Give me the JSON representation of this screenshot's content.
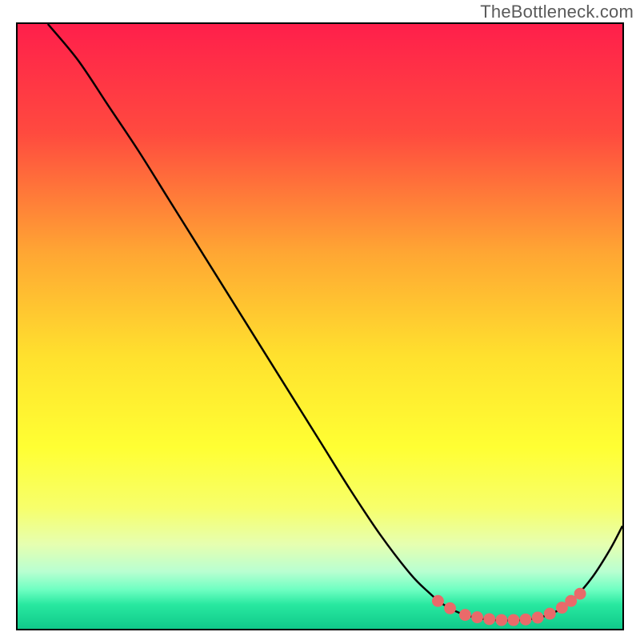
{
  "watermark": "TheBottleneck.com",
  "chart_data": {
    "type": "line",
    "title": "",
    "xlabel": "",
    "ylabel": "",
    "xlim": [
      0,
      100
    ],
    "ylim": [
      0,
      100
    ],
    "grid": false,
    "background_gradient": {
      "stops": [
        {
          "offset": 0.0,
          "color": "#ff1f4b"
        },
        {
          "offset": 0.18,
          "color": "#ff4a3f"
        },
        {
          "offset": 0.38,
          "color": "#ffa733"
        },
        {
          "offset": 0.55,
          "color": "#ffe12e"
        },
        {
          "offset": 0.7,
          "color": "#ffff33"
        },
        {
          "offset": 0.8,
          "color": "#f7ff6b"
        },
        {
          "offset": 0.86,
          "color": "#e6ffb0"
        },
        {
          "offset": 0.905,
          "color": "#b9ffd1"
        },
        {
          "offset": 0.935,
          "color": "#6fffc2"
        },
        {
          "offset": 0.96,
          "color": "#28e8a0"
        },
        {
          "offset": 1.0,
          "color": "#10c98a"
        }
      ]
    },
    "series": [
      {
        "name": "bottleneck-curve",
        "color": "#000000",
        "x": [
          5,
          10,
          15,
          20,
          25,
          30,
          35,
          40,
          45,
          50,
          55,
          60,
          65,
          68,
          70,
          72,
          74,
          76,
          78,
          80,
          82,
          84,
          86,
          88,
          90,
          92,
          95,
          98,
          100
        ],
        "y": [
          100,
          94,
          86.5,
          79,
          71,
          63,
          55,
          47,
          39,
          31,
          23,
          15.5,
          9,
          6,
          4.3,
          3.1,
          2.3,
          1.8,
          1.5,
          1.4,
          1.4,
          1.5,
          1.8,
          2.4,
          3.4,
          5.0,
          8.5,
          13.2,
          17
        ]
      }
    ],
    "markers": {
      "name": "optimal-range-dots",
      "color": "#e96a6a",
      "radius_px": 7,
      "points": [
        {
          "x": 69.5,
          "y": 4.6
        },
        {
          "x": 71.5,
          "y": 3.4
        },
        {
          "x": 74.0,
          "y": 2.3
        },
        {
          "x": 76.0,
          "y": 1.9
        },
        {
          "x": 78.0,
          "y": 1.6
        },
        {
          "x": 80.0,
          "y": 1.45
        },
        {
          "x": 82.0,
          "y": 1.45
        },
        {
          "x": 84.0,
          "y": 1.55
        },
        {
          "x": 86.0,
          "y": 1.85
        },
        {
          "x": 88.0,
          "y": 2.5
        },
        {
          "x": 90.0,
          "y": 3.5
        },
        {
          "x": 91.5,
          "y": 4.6
        },
        {
          "x": 93.0,
          "y": 5.8
        }
      ]
    }
  }
}
